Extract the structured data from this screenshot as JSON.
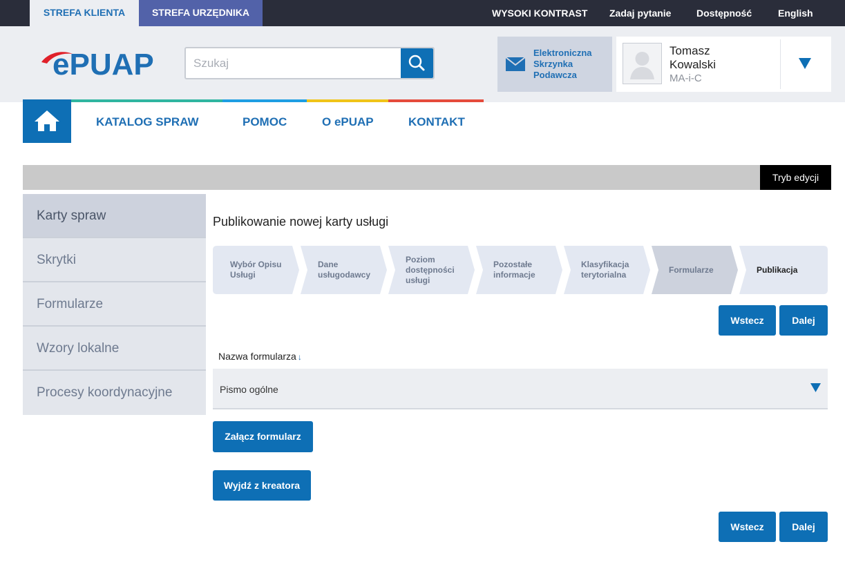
{
  "topbar": {
    "tab_client": "STREFA KLIENTA",
    "tab_official": "STREFA URZĘDNIKA",
    "links": [
      "WYSOKI KONTRAST",
      "Zadaj pytanie",
      "Dostępność",
      "English"
    ]
  },
  "header": {
    "logo_text": "ePUAP",
    "search_placeholder": "Szukaj",
    "search_icon": "search-icon",
    "inbox_line1": "Elektroniczna",
    "inbox_line2": "Skrzynka",
    "inbox_line3": "Podawcza",
    "inbox_icon": "envelope-icon",
    "user": {
      "first_name": "Tomasz",
      "last_name": "Kowalski",
      "role": "MA-i-C"
    }
  },
  "nav": {
    "home_icon": "home-icon",
    "links": [
      "KATALOG SPRAW",
      "POMOC",
      "O ePUAP",
      "KONTAKT"
    ]
  },
  "edit_mode_label": "Tryb edycji",
  "sidebar": {
    "items": [
      {
        "label": "Karty spraw",
        "active": true
      },
      {
        "label": "Skrytki",
        "active": false
      },
      {
        "label": "Formularze",
        "active": false
      },
      {
        "label": "Wzory lokalne",
        "active": false
      },
      {
        "label": "Procesy koordynacyjne",
        "active": false
      }
    ]
  },
  "main": {
    "title": "Publikowanie nowej karty usługi",
    "steps": [
      {
        "label": "Wybór Opisu Usługi",
        "state": "done"
      },
      {
        "label": "Dane usługodawcy",
        "state": "done"
      },
      {
        "label": "Poziom dostępności usługi",
        "state": "done"
      },
      {
        "label": "Pozostałe informacje",
        "state": "done"
      },
      {
        "label": "Klasyfikacja terytorialna",
        "state": "done"
      },
      {
        "label": "Formularze",
        "state": "current"
      },
      {
        "label": "Publikacja",
        "state": "next"
      }
    ],
    "back_label": "Wstecz",
    "next_label": "Dalej",
    "column_header": "Nazwa formularza",
    "form_name": "Pismo ogólne",
    "attach_label": "Załącz formularz",
    "exit_label": "Wyjdź z kreatora"
  },
  "colors": {
    "brand_blue": "#0e6fb5",
    "topbar": "#2a2d3a",
    "official_tab": "#5262a9",
    "stripe": [
      "#2fb5a0",
      "#1e9ee3",
      "#f0c419",
      "#e54b3c"
    ]
  }
}
